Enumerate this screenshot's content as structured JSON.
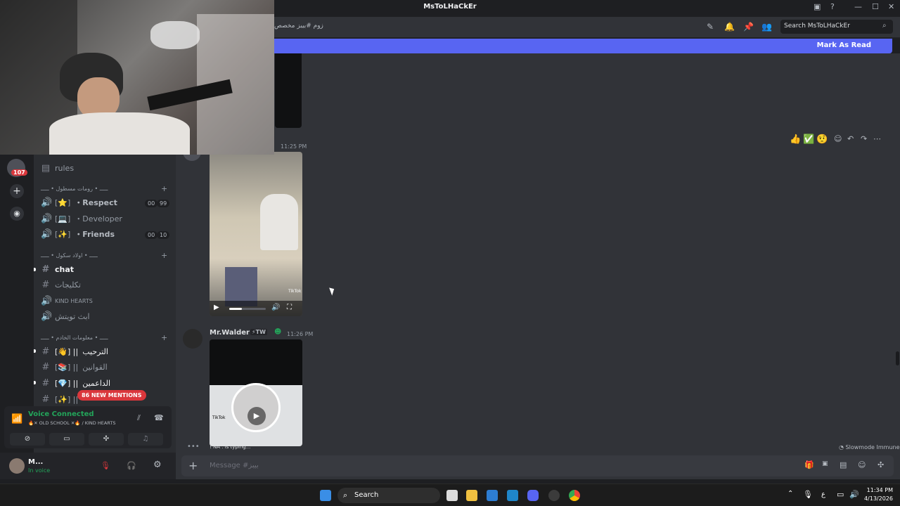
{
  "window": {
    "title": "MsToLHaCkEr"
  },
  "header": {
    "channel_crumb": "زوم #بيبز مخصص",
    "search_placeholder": "Search MsToLHaCkEr"
  },
  "banner": {
    "mark_as_read": "Mark As Read"
  },
  "serverbar": {
    "badge_count": "107"
  },
  "sidebar": {
    "rules_label": "rules",
    "category1": "ـــــ • رومات مسطول • ـــــ",
    "voice_channels": [
      {
        "emoji": "⭐",
        "name": "・Respect",
        "count_a": "00",
        "count_b": "99"
      },
      {
        "emoji": "💻",
        "name": "・Developer",
        "count_a": "",
        "count_b": ""
      },
      {
        "emoji": "✨",
        "name": "・Friends",
        "count_a": "00",
        "count_b": "10"
      }
    ],
    "category2": "ـــــ • اولاد سكول • ـــــ",
    "text_channels": [
      "chat",
      "تكليجات",
      "KIND HEARTS",
      "ابث تويتش"
    ],
    "category3": "ـــــ • معلومات الخادم • ـــــ",
    "info_channels": [
      {
        "emoji": "👋",
        "name": "الترحيب"
      },
      {
        "emoji": "📚",
        "name": "القوانين"
      },
      {
        "emoji": "💎",
        "name": "الداعمين"
      },
      {
        "emoji": "✨",
        "name": ""
      }
    ],
    "mentions_pill": "86 NEW MENTIONS"
  },
  "voice_panel": {
    "status": "Voice Connected",
    "channel": "🔥✕ OLD SCHOOL ✕🔥 / KIND HEARTS"
  },
  "user_panel": {
    "name": "M...",
    "status": "In voice"
  },
  "messages": [
    {
      "time": "11:25 PM",
      "author": "",
      "video_label": "TikTok"
    },
    {
      "time": "11:26 PM",
      "author": "Mr.Walder",
      "tag": "⚡TW",
      "video_label": "TikTok"
    }
  ],
  "typing": {
    "text": "! NA . is typing..."
  },
  "slowmode": {
    "text": "Slowmode Immune"
  },
  "composer": {
    "placeholder": "Message #بيبز"
  },
  "taskbar": {
    "search_label": "Search",
    "time": "11:34 PM",
    "date": "4/13/2026",
    "lang": "ع"
  },
  "colors": {
    "blurple": "#5865f2",
    "green": "#23a55a",
    "red": "#da373c"
  }
}
